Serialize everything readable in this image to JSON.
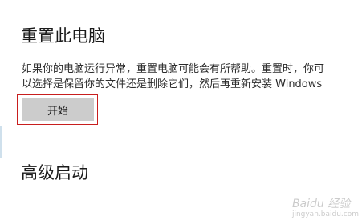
{
  "reset_section": {
    "title": "重置此电脑",
    "description_line1": "如果你的电脑运行异常，重置电脑可能会有所帮助。重置时，你可",
    "description_line2": "以选择是保留你的文件还是删除它们，然后再重新安装 Windows",
    "start_button_label": "开始"
  },
  "advanced_startup": {
    "title": "高级启动"
  },
  "watermark": {
    "text": "Baidu 经验",
    "subtext": "jingyan.baidu.com"
  },
  "colors": {
    "highlight_border": "#c81e1e",
    "button_bg": "#cccccc"
  }
}
